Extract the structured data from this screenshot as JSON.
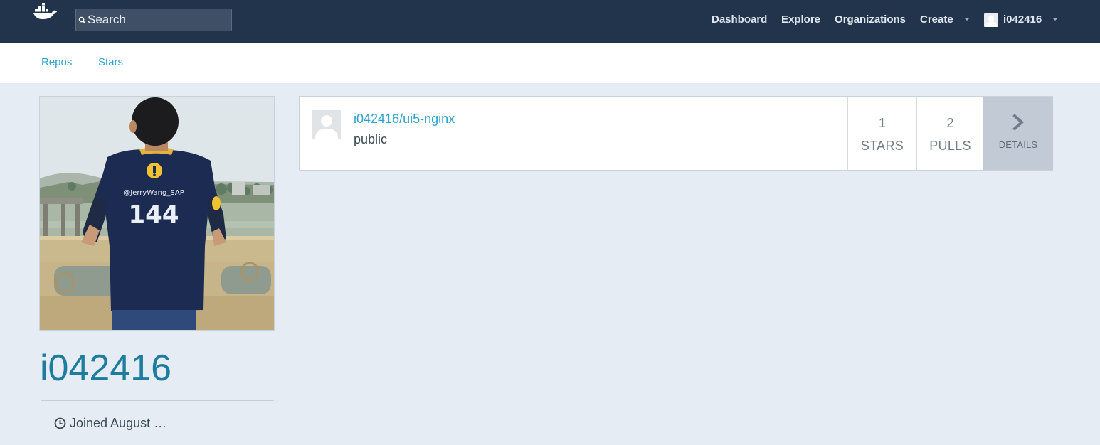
{
  "navbar": {
    "logo": "docker-whale-icon",
    "search": {
      "placeholder": "Search",
      "value": ""
    },
    "links": {
      "dashboard": "Dashboard",
      "explore": "Explore",
      "organizations": "Organizations",
      "create": "Create"
    },
    "user": "i042416"
  },
  "subnav": {
    "tabs": {
      "repos": "Repos",
      "stars": "Stars"
    }
  },
  "profile": {
    "username": "i042416",
    "joined": "Joined August …",
    "photo": {
      "shirt_handle": "@JerryWang_SAP",
      "shirt_number": "144"
    }
  },
  "repositories": [
    {
      "name": "i042416/ui5-nginx",
      "visibility": "public",
      "stars_value": "1",
      "stars_label": "STARS",
      "pulls_value": "2",
      "pulls_label": "PULLS",
      "details_label": "DETAILS"
    }
  ],
  "colors": {
    "navbar": "#22344c",
    "link_blue": "#2aa3cc",
    "username_blue": "#1e7c9d",
    "page_bg": "#e5ecf4",
    "details_bg": "#c2cbd5"
  }
}
